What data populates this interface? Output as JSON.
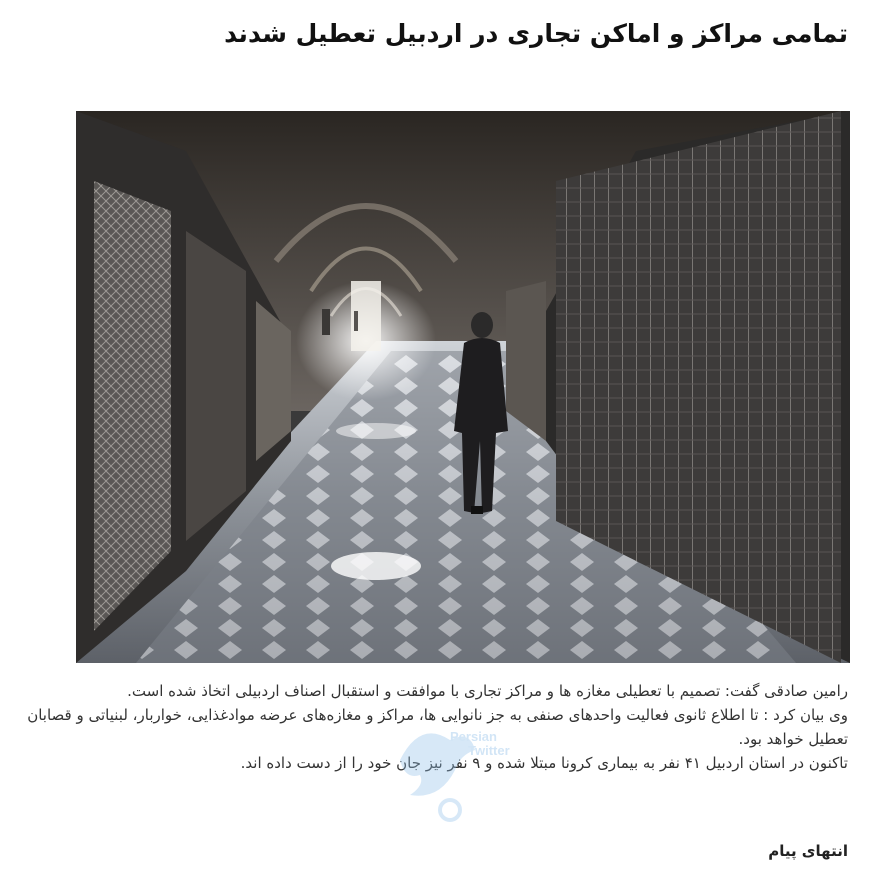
{
  "article": {
    "headline": "تمامی مراکز و اماکن تجاری در اردبیل تعطیل شدند",
    "paragraphs": [
      "رامین صادقی گفت: تصمیم با تعطیلی مغازه ها و مراکز تجاری با موافقت و استقبال اصناف اردبیلی اتخاذ شده است.",
      "وی بیان کرد : تا اطلاع ثانوی  فعالیت واحدهای صنفی به جز  نانوایی ها، مراکز و مغازه‌های عرضه موادغذایی، خواربار، لبنیاتی و قصابان  تعطیل خواهد بود.",
      "تاکنون در استان اردبیل ۴۱ نفر به بیماری کرونا مبتلا شده و ۹ نفر نیز جان خود را از دست داده اند."
    ],
    "end_label": "انتهای پیام"
  },
  "watermark": {
    "line1": "Persian",
    "line2": "Twitter"
  }
}
